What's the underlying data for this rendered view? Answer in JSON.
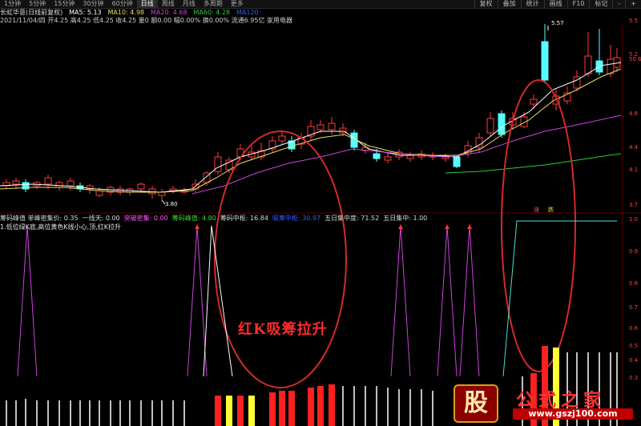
{
  "timeframes": [
    "1分钟",
    "5分钟",
    "15分钟",
    "30分钟",
    "60分钟",
    "日线",
    "周线",
    "月线",
    "多周期",
    "更多"
  ],
  "active_timeframe": 5,
  "top_right_buttons": [
    "复权",
    "叠加",
    "统计",
    "画线",
    "F10",
    "标记",
    "-",
    "+"
  ],
  "toolbar": {
    "name": "长虹华意(日线前复权)",
    "ma5": "MA5: 5.13",
    "ma10": "MA10: 4.98",
    "ma20": "MA20: 4.68",
    "ma60": "MA60: 4.28",
    "ma120": "MA120:"
  },
  "infobar": "2021/11/04/四 开4.25 高4.25 低4.25 收4.25 量0 额0.00 幅0.00% 换0.00% 流通6.95亿 家用电器",
  "price_axis": [
    "5.5",
    "5.2",
    "50.6",
    "4.8",
    "4.4",
    "4.1",
    "3.7"
  ],
  "sub_axis": [
    "1.0",
    "0.9",
    "0.8",
    "0.7",
    "0.6",
    "0.5",
    "0.4",
    "0.3"
  ],
  "peak_labels": {
    "high": "5.57",
    "low": "3.80"
  },
  "marks": [
    "涨",
    "跌"
  ],
  "indicator_bar": [
    {
      "text": "筹码峰值 单峰密集价: 0.35",
      "color": "#d8d8d8"
    },
    {
      "text": "一线天: 0.00",
      "color": "#d8d8d8"
    },
    {
      "text": "突破密集: 0.00",
      "color": "#ff55ff"
    },
    {
      "text": "筹码峰值: 4.80",
      "color": "#33dd33"
    },
    {
      "text": "筹码中枢: 16.84",
      "color": "#d8d8d8"
    },
    {
      "text": "吸筹中枢: 30.97",
      "color": "#3a5cff"
    },
    {
      "text": "五日集中度: 71.52",
      "color": "#d8d8d8"
    },
    {
      "text": "五日集中: 1.00",
      "color": "#d8d8d8"
    }
  ],
  "sub_note": "1.低位绿K底,高位黄色K线小心,顶,红K拉升",
  "overlay_text": "红K吸筹拉升",
  "watermark": {
    "logo": "股",
    "title": "公式之家",
    "url": "www.gszj100.com"
  },
  "colors": {
    "up": "#ff3a3a",
    "down": "#54ffff",
    "ma5": "#ffffff",
    "ma10": "#e6e060",
    "ma20": "#cc44dd",
    "ma60": "#33cc33",
    "ellipse": "#d42a2a",
    "spike": "#cc44dd"
  }
}
